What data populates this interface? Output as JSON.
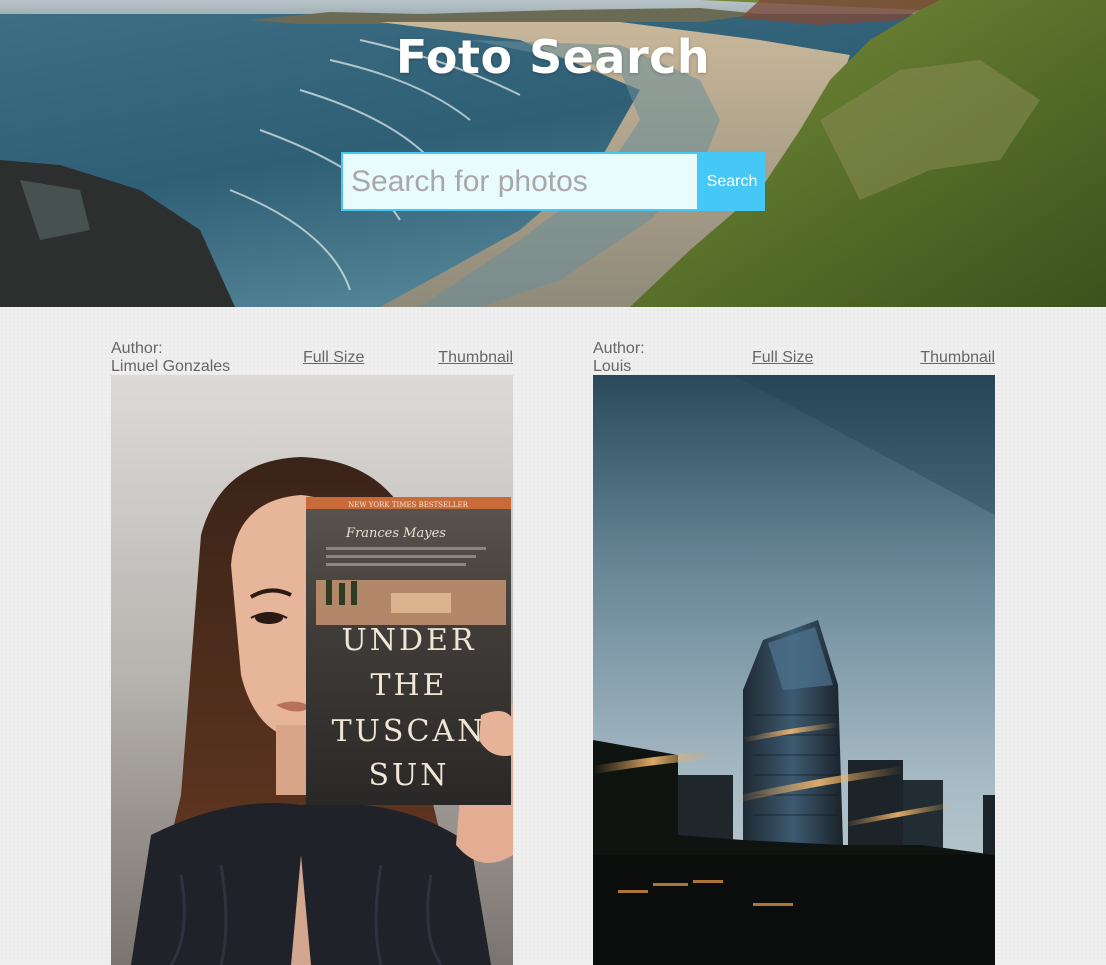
{
  "header": {
    "title": "Foto Search"
  },
  "search": {
    "placeholder": "Search for photos",
    "value": "",
    "button_label": "Search"
  },
  "photos": [
    {
      "author_label": "Author:",
      "author_name": "Limuel Gonzales",
      "full_size_label": "Full Size",
      "thumbnail_label": "Thumbnail",
      "book_text": {
        "banner": "NEW YORK TIMES BESTSELLER",
        "author": "Frances Mayes",
        "line1": "UNDER",
        "line2": "THE",
        "line3": "TUSCAN",
        "line4": "SUN"
      }
    },
    {
      "author_label": "Author:",
      "author_name": "Louis",
      "full_size_label": "Full Size",
      "thumbnail_label": "Thumbnail"
    }
  ],
  "colors": {
    "accent": "#45c8f5",
    "input_bg": "#e8fbfd",
    "page_bg": "#efefef",
    "text_muted": "#666666"
  }
}
